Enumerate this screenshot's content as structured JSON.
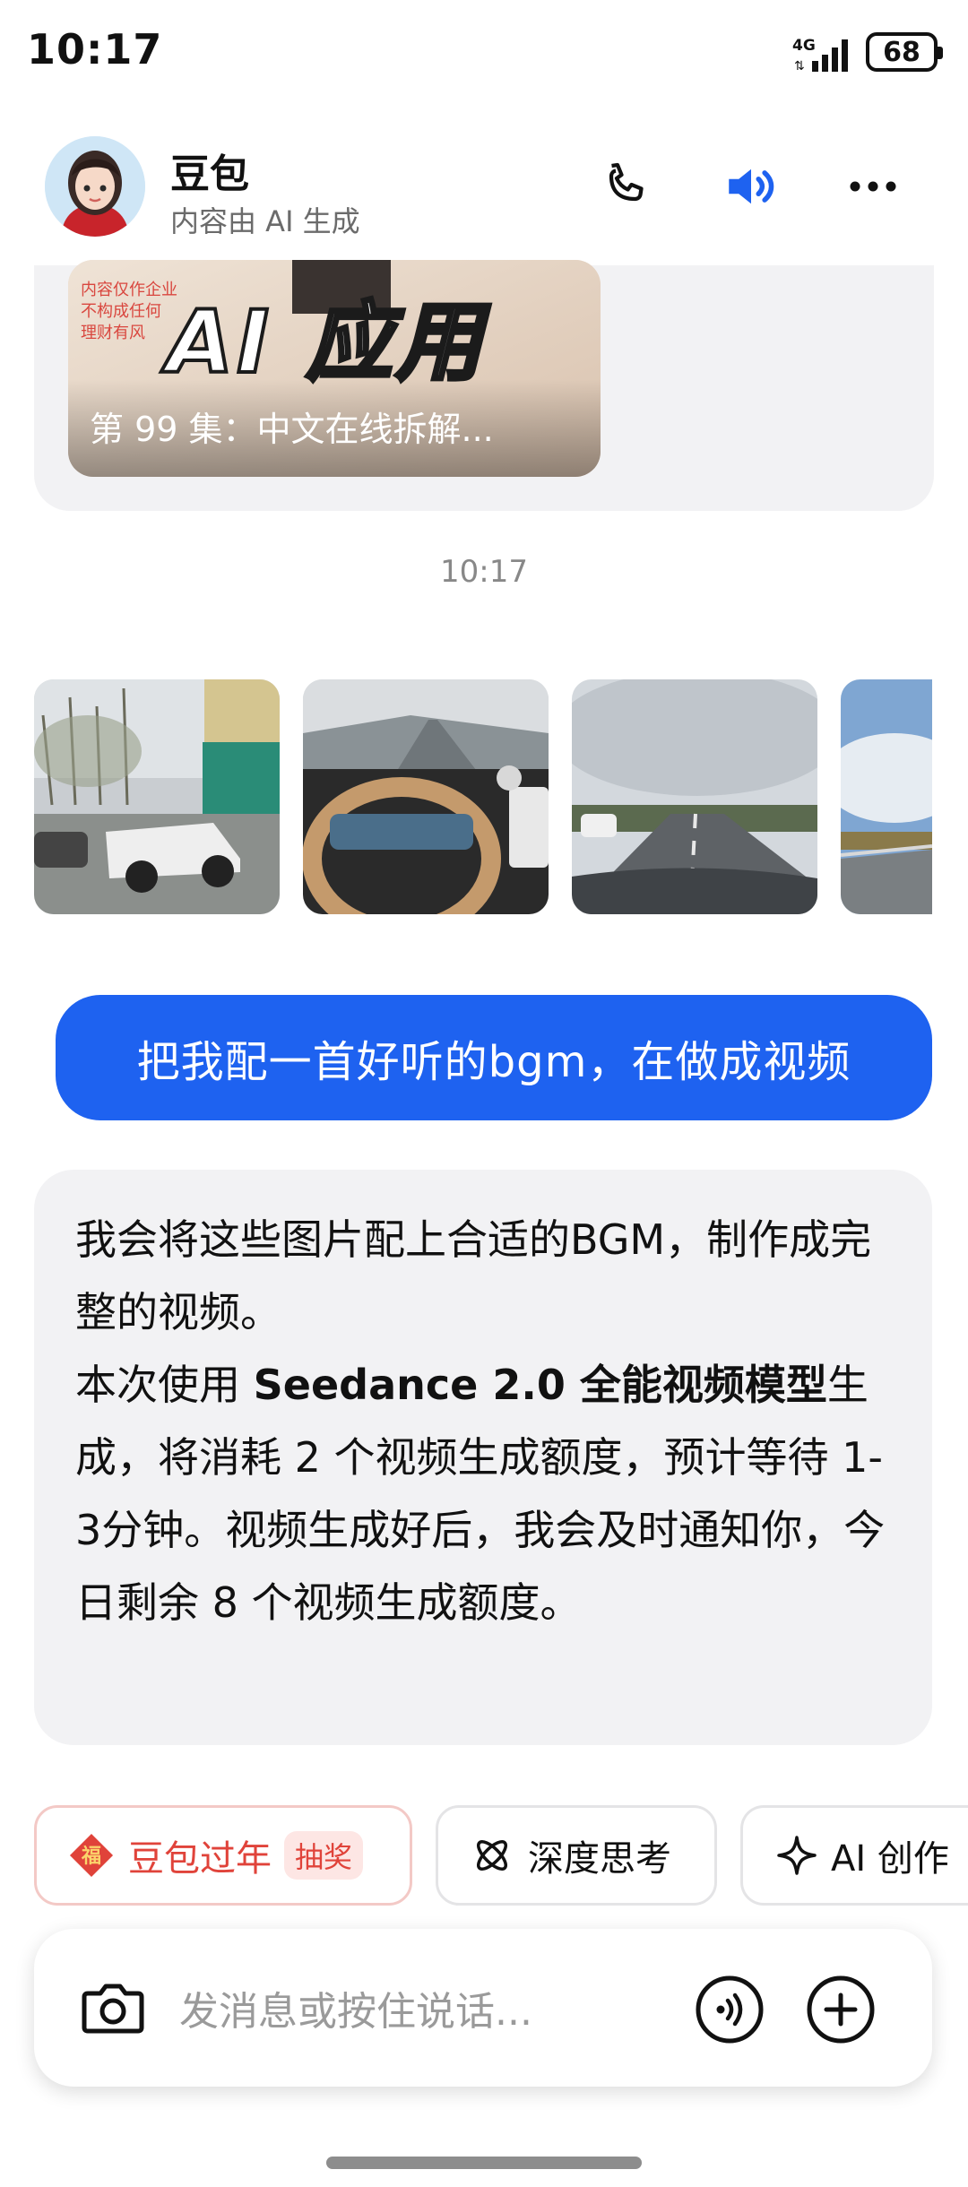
{
  "status_bar": {
    "time": "10:17",
    "network": "4G",
    "battery": "68"
  },
  "header": {
    "name": "豆包",
    "subtitle": "内容由 AI 生成"
  },
  "video_card": {
    "overlay_text": "AI 应用",
    "small_text_lines": [
      "内容仅作企业",
      "不构成任何",
      "理财有风"
    ],
    "caption": "第 99 集：中文在线拆解..."
  },
  "timestamp": "10:17",
  "photos": [
    {
      "name": "photo-parked-cars",
      "desc": "cars"
    },
    {
      "name": "photo-car-interior",
      "desc": "interior"
    },
    {
      "name": "photo-highway",
      "desc": "highway"
    },
    {
      "name": "photo-sky",
      "desc": "sky"
    }
  ],
  "user_message": "把我配一首好听的bgm，在做成视频",
  "bot_message": {
    "line1": "我会将这些图片配上合适的BGM，制作成完整的视频。",
    "line2_prefix": "本次使用 ",
    "line2_bold": "Seedance 2.0 全能视频模型",
    "line2_suffix": "生成，将消耗 2 个视频生成额度，预计等待 1-3分钟。视频生成好后，我会及时通知你，今日剩余 8 个视频生成额度。"
  },
  "chips": [
    {
      "label": "豆包过年",
      "badge": "抽奖",
      "icon": "fu-icon"
    },
    {
      "label": "深度思考",
      "icon": "atom-icon"
    },
    {
      "label": "AI 创作",
      "icon": "sparkle-icon"
    }
  ],
  "input": {
    "placeholder": "发消息或按住说话..."
  },
  "colors": {
    "accent": "#1e62f0",
    "bubble_bg": "#f2f2f4",
    "chip_red": "#e0433a"
  }
}
